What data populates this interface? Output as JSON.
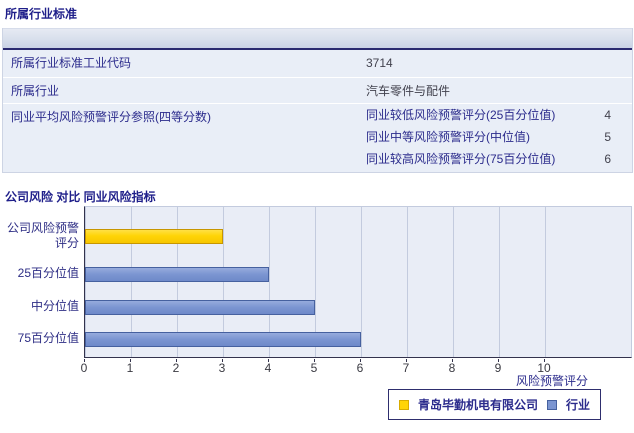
{
  "section1": {
    "title": "所属行业标准",
    "rows": [
      {
        "label": "所属行业标准工业代码",
        "value": "3714"
      },
      {
        "label": "所属行业",
        "value": "汽车零件与配件"
      },
      {
        "label": "同业平均风险预警评分参照(四等分数)",
        "subrows": [
          {
            "label": "同业较低风险预警评分(25百分位值)",
            "value": "4"
          },
          {
            "label": "同业中等风险预警评分(中位值)",
            "value": "5"
          },
          {
            "label": "同业较高风险预警评分(75百分位值)",
            "value": "6"
          }
        ]
      }
    ]
  },
  "section2": {
    "title": "公司风险 对比 同业风险指标"
  },
  "chart_data": {
    "type": "bar",
    "orientation": "horizontal",
    "title": "公司风险 对比 同业风险指标",
    "categories": [
      "公司风险预警评分",
      "25百分位值",
      "中分位值",
      "75百分位值"
    ],
    "values": [
      3,
      4,
      5,
      6
    ],
    "series": [
      {
        "name": "青岛毕勤机电有限公司",
        "color": "#FFD406",
        "values": [
          3
        ]
      },
      {
        "name": "行业",
        "color": "#7B95D1",
        "values": [
          4,
          5,
          6
        ]
      }
    ],
    "xlabel": "风险预警评分",
    "xlim": [
      0,
      10
    ],
    "xticks": [
      0,
      1,
      2,
      3,
      4,
      5,
      6,
      7,
      8,
      9,
      10
    ],
    "grid": true,
    "legend_position": "bottom",
    "legend": [
      {
        "label": "青岛毕勤机电有限公司",
        "color": "#FFD406"
      },
      {
        "label": "行业",
        "color": "#7B95D1"
      }
    ],
    "plot_bg": "#E9EDF6",
    "gridline_color": "#C3CBDE"
  }
}
